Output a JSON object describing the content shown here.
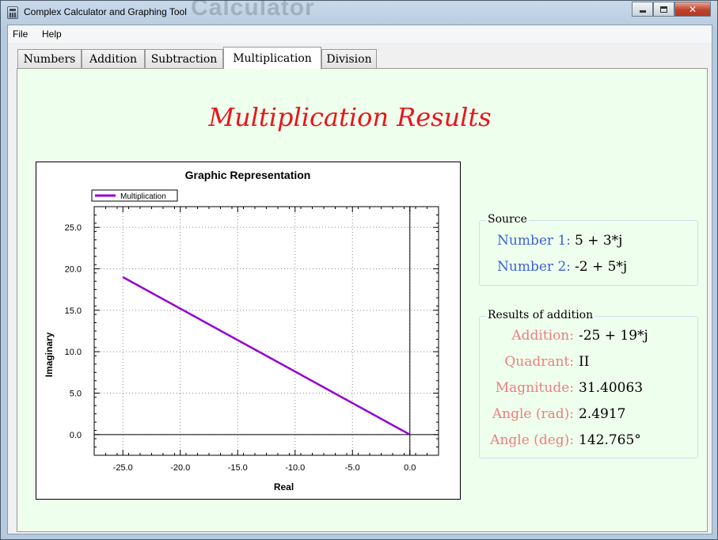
{
  "window": {
    "title": "Complex Calculator and Graphing Tool",
    "ghost_title": "Calculator"
  },
  "menu": {
    "file": "File",
    "help": "Help"
  },
  "tabs": [
    "Numbers",
    "Addition",
    "Subtraction",
    "Multiplication",
    "Division"
  ],
  "active_tab": "Multiplication",
  "heading": "Multiplication Results",
  "source": {
    "title": "Source",
    "number1_label": "Number 1:",
    "number1_value": "5 + 3*j",
    "number2_label": "Number 2:",
    "number2_value": "-2 + 5*j"
  },
  "results": {
    "title": "Results of addition",
    "rows": [
      {
        "label": "Addition:",
        "value": "-25 + 19*j"
      },
      {
        "label": "Quadrant:",
        "value": "II"
      },
      {
        "label": "Magnitude:",
        "value": "31.40063"
      },
      {
        "label": "Angle (rad):",
        "value": "2.4917"
      },
      {
        "label": "Angle (deg):",
        "value": "142.765°"
      }
    ]
  },
  "colors": {
    "heading": "#e8151b",
    "panel_bg": "#efffed",
    "line": "#9400d3",
    "label_blue": "#3d62d4",
    "label_pink": "#ec7f7f"
  },
  "chart_data": {
    "type": "line",
    "title": "Graphic Representation",
    "xlabel": "Real",
    "ylabel": "Imaginary",
    "xlim": [
      -27.5,
      2.5
    ],
    "ylim": [
      -2.5,
      27.5
    ],
    "x_ticks": [
      "-25.0",
      "-20.0",
      "-15.0",
      "-10.0",
      "-5.0",
      "0.0"
    ],
    "y_ticks": [
      "0.0",
      "5.0",
      "10.0",
      "15.0",
      "20.0",
      "25.0"
    ],
    "grid": true,
    "legend_position": "top-left",
    "series": [
      {
        "name": "Multiplication",
        "x": [
          -25,
          0
        ],
        "y": [
          19,
          0
        ]
      }
    ]
  }
}
